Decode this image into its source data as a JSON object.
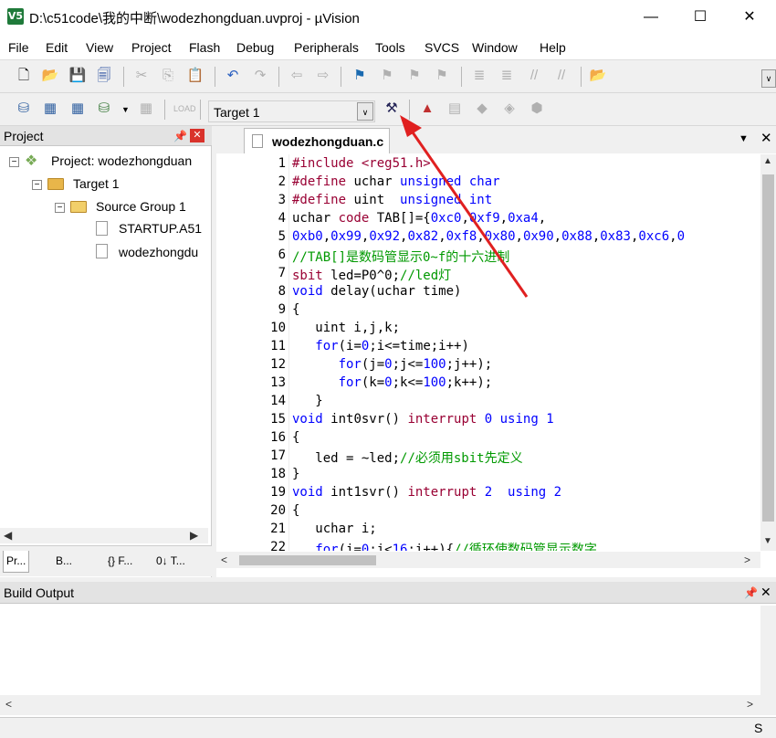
{
  "window": {
    "title": "D:\\c51code\\我的中断\\wodezhongduan.uvproj - µVision",
    "icon_text": "V5"
  },
  "window_controls": {
    "minimize": "—",
    "maximize": "☐",
    "close": "✕"
  },
  "menu": [
    "File",
    "Edit",
    "View",
    "Project",
    "Flash",
    "Debug",
    "Peripherals",
    "Tools",
    "SVCS",
    "Window",
    "Help"
  ],
  "toolbar2": {
    "target": "Target 1"
  },
  "project_pane": {
    "title": "Project",
    "tree": {
      "project": "Project: wodezhongduan",
      "target": "Target 1",
      "group": "Source Group 1",
      "files": [
        "STARTUP.A51",
        "wodezhongdu"
      ]
    },
    "tabs": [
      "Pr...",
      "B...",
      "{} F...",
      "0↓ T..."
    ]
  },
  "editor": {
    "tab": "wodezhongduan.c",
    "line_numbers": [
      "1",
      "2",
      "3",
      "4",
      "5",
      "6",
      "7",
      "8",
      "9",
      "10",
      "11",
      "12",
      "13",
      "14",
      "15",
      "16",
      "17",
      "18",
      "19",
      "20",
      "21",
      "22"
    ]
  },
  "build_output": {
    "title": "Build Output"
  },
  "status": {
    "right": "S"
  },
  "colors": {
    "keyword": "#0000ff",
    "preproc": "#990033",
    "comment": "#009900",
    "arrow": "#e02020"
  }
}
